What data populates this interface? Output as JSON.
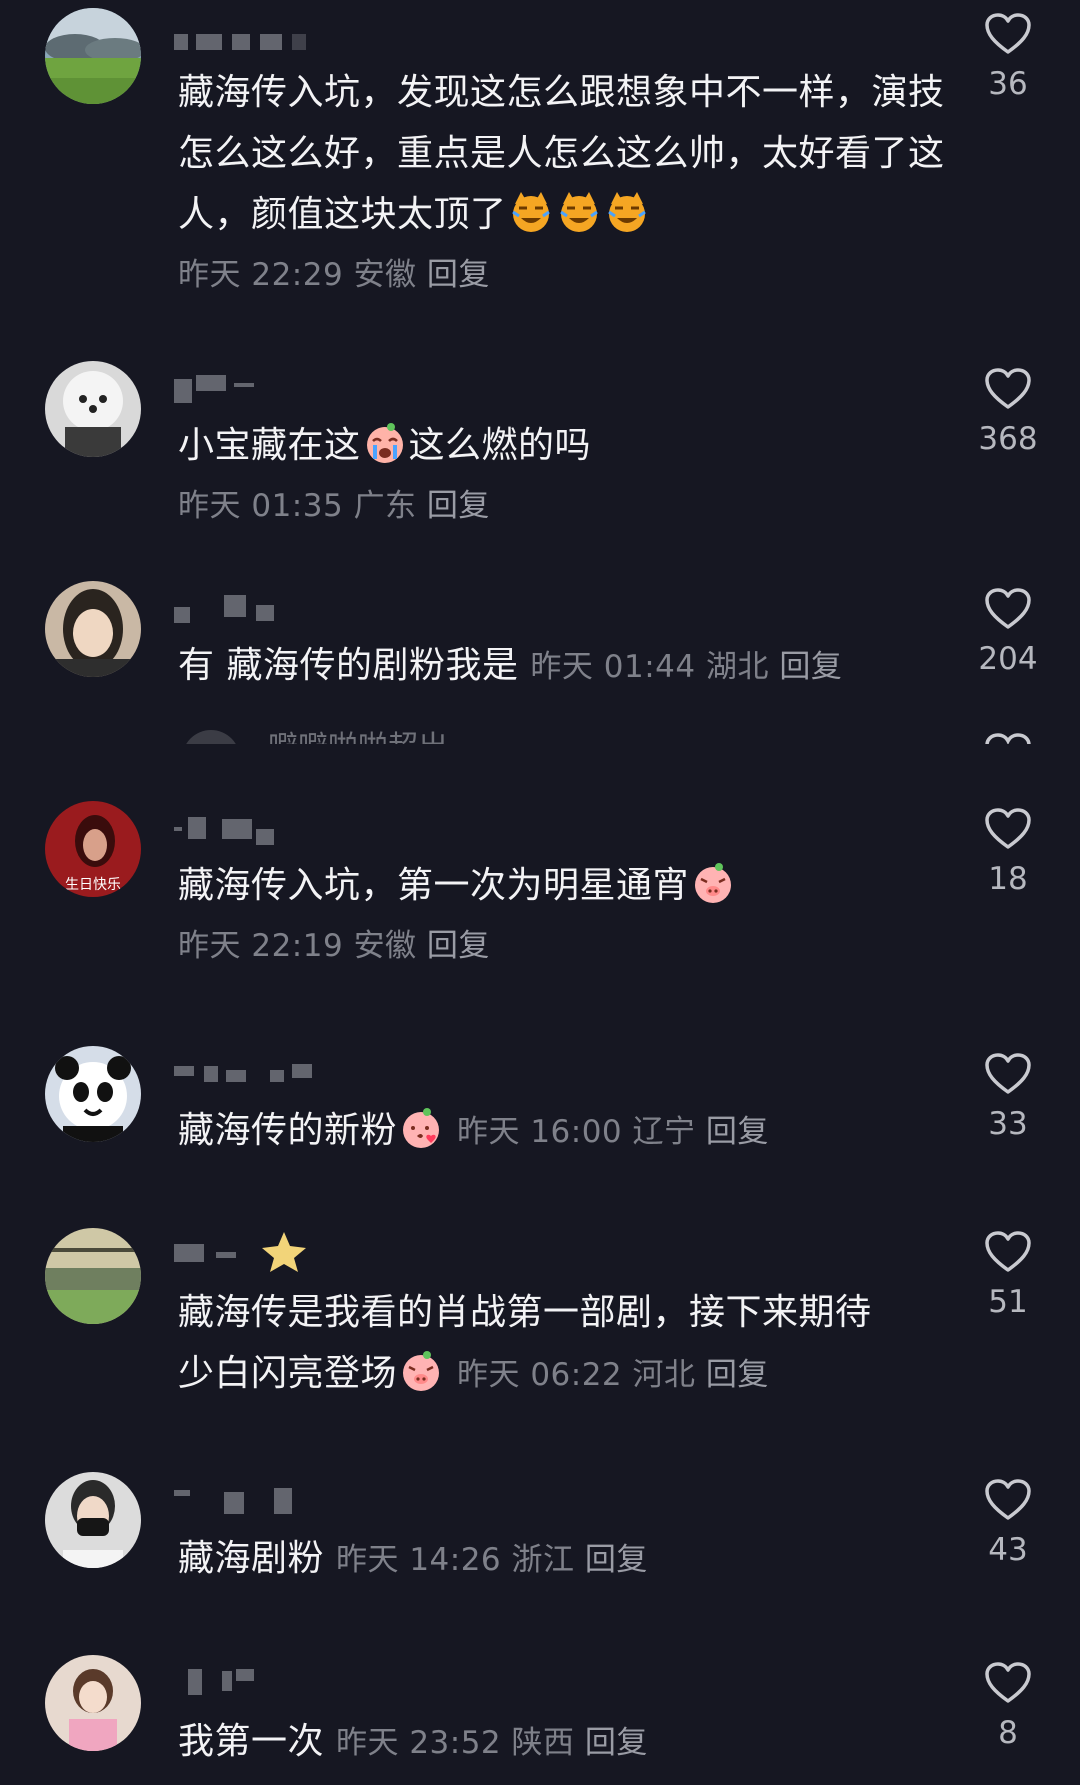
{
  "comments": [
    {
      "text": "藏海传入坑，发现这怎么跟想象中不一样，演技怎么这么好，重点是人怎么这么帅，太好看了这人，颜值这块太顶了",
      "emoji_count": 3,
      "emoji_kind": "cat-laughing-crying-icon",
      "time": "昨天 22:29",
      "location": "安徽",
      "reply_label": "回复",
      "likes": "36"
    },
    {
      "text_before": "小宝藏在这",
      "text_after": "这么燃的吗",
      "emoji_kind": "crying-face-icon",
      "time": "昨天 01:35",
      "location": "广东",
      "reply_label": "回复",
      "likes": "368"
    },
    {
      "text": "有  藏海传的剧粉我是",
      "time": "昨天 01:44",
      "location": "湖北",
      "reply_label": "回复",
      "likes": "204"
    },
    {
      "text": "藏海传入坑，第一次为明星通宵",
      "emoji_kind": "pig-face-icon",
      "time": "昨天 22:19",
      "location": "安徽",
      "reply_label": "回复",
      "likes": "18"
    },
    {
      "text": "藏海传的新粉",
      "emoji_kind": "pig-kiss-icon",
      "time": "昨天 16:00",
      "location": "辽宁",
      "reply_label": "回复",
      "likes": "33"
    },
    {
      "text_line1": "藏海传是我看的肖战第一部剧，接下来期待",
      "text_line2": "少白闪亮登场",
      "emoji_kind": "pig-face-icon",
      "time": "昨天 06:22",
      "location": "河北",
      "reply_label": "回复",
      "likes": "51"
    },
    {
      "text": "藏海剧粉",
      "time": "昨天 14:26",
      "location": "浙江",
      "reply_label": "回复",
      "likes": "43"
    },
    {
      "text": "我第一次",
      "time": "昨天 23:52",
      "location": "陕西",
      "reply_label": "回复",
      "likes": "8"
    }
  ],
  "folded": {
    "text": "噼噼啪啪超出"
  },
  "avatar_texts": {
    "birthday": "生日快乐"
  },
  "colors": {
    "background": "#161722",
    "text": "#f3f3f5",
    "meta": "#7f818a",
    "heart": "#c9cad0"
  }
}
